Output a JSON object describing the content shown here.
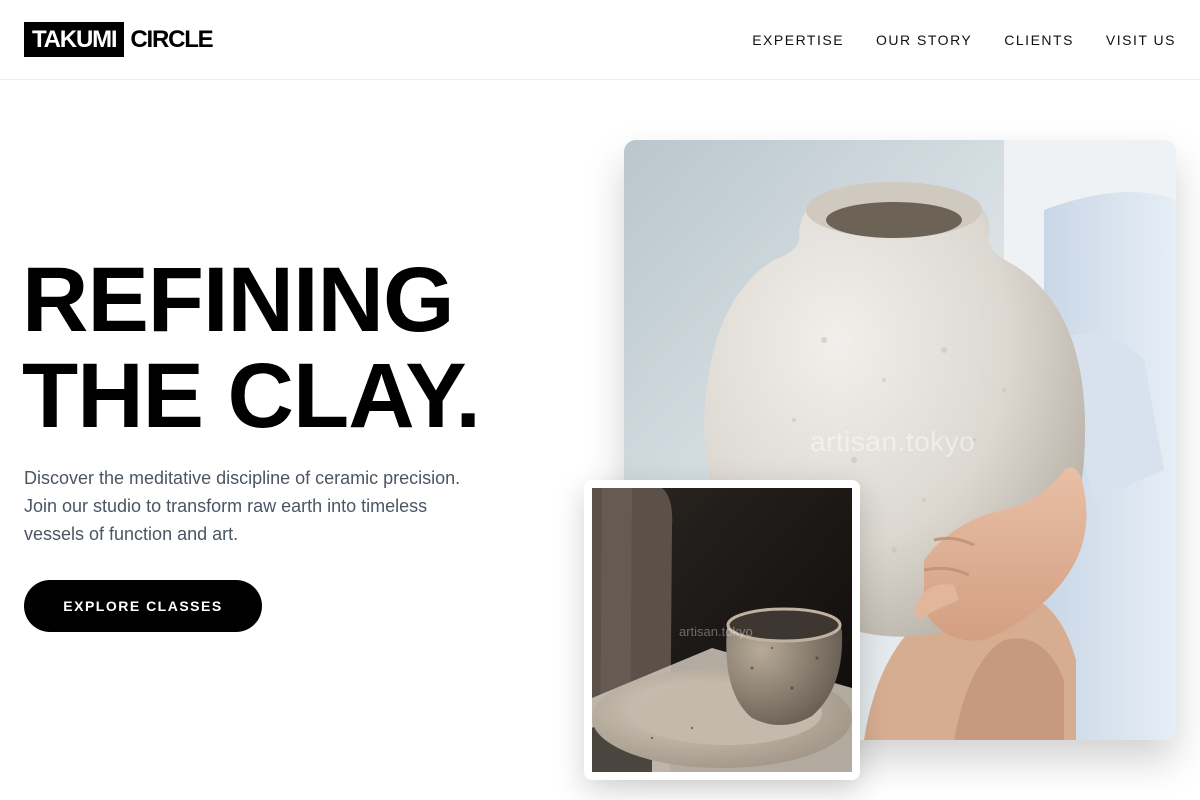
{
  "header": {
    "logo_box_text": "TAKUMI",
    "logo_text": "CIRCLE",
    "nav": [
      {
        "label": "EXPERTISE"
      },
      {
        "label": "OUR STORY"
      },
      {
        "label": "CLIENTS"
      },
      {
        "label": "VISIT US"
      }
    ]
  },
  "hero": {
    "title_line1": "REFINING",
    "title_line2": "THE CLAY.",
    "description": "Discover the meditative discipline of ceramic precision. Join our studio to transform raw earth into timeless vessels of function and art.",
    "cta_label": "EXPLORE CLASSES"
  },
  "images": {
    "main_watermark": "artisan.tokyo",
    "inset_watermark": "artisan.tokyo"
  }
}
